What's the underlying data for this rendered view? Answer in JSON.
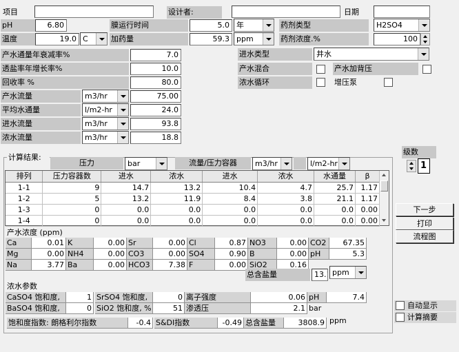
{
  "top": {
    "project_label": "项目",
    "project_value": "",
    "designer_label": "设计者:",
    "designer_value": "",
    "date_label": "日期",
    "date_value": "",
    "ph_label": "pH",
    "ph_value": "6.80",
    "membrane_time_label": "膜运行时间",
    "membrane_time_value": "5.0",
    "membrane_time_unit": "年",
    "chemical_type_label": "药剂类型",
    "chemical_type_value": "H2SO4",
    "temp_label": "温度",
    "temp_value": "19.0",
    "temp_unit": "C",
    "dosage_label": "加药量",
    "dosage_value": "59.3",
    "dosage_unit": "ppm",
    "chem_conc_label": "药剂浓度.%",
    "chem_conc_value": "100"
  },
  "params": {
    "decline_label": "产水通量年衰减率%",
    "decline_value": "7.0",
    "passage_label": "透盐率年增长率%",
    "passage_value": "10.0",
    "recovery_label": "回收率 %",
    "recovery_value": "80.0",
    "product_flow_label": "产水流量",
    "product_flow_unit": "m3/hr",
    "product_flow_value": "75.00",
    "avg_flux_label": "平均水通量",
    "avg_flux_unit": "l/m2-hr",
    "avg_flux_value": "24.0",
    "feed_flow_label": "进水流量",
    "feed_flow_unit": "m3/hr",
    "feed_flow_value": "93.8",
    "conc_flow_label": "浓水流量",
    "conc_flow_unit": "m3/hr",
    "conc_flow_value": "18.8"
  },
  "feed": {
    "type_label": "进水类型",
    "type_value": "井水",
    "product_mix_label": "产水混合",
    "product_backpressure_label": "产水加背压",
    "conc_recycle_label": "浓水循环",
    "booster_label": "增压泵"
  },
  "stages": {
    "label": "级数",
    "value": "1"
  },
  "results": {
    "title": "计算结果:",
    "pressure_label": "压力",
    "pressure_unit": "bar",
    "flow_vessel_label": "流量/压力容器",
    "flow_unit": "m3/hr",
    "flux_unit": "l/m2-hr",
    "columns": [
      "排列",
      "压力容器数",
      "进水",
      "浓水",
      "进水",
      "浓水",
      "水通量",
      "β"
    ],
    "rows": [
      [
        "1-1",
        "9",
        "14.7",
        "13.2",
        "10.4",
        "4.7",
        "25.7",
        "1.17"
      ],
      [
        "1-2",
        "5",
        "13.2",
        "11.9",
        "8.4",
        "3.8",
        "21.1",
        "1.17"
      ],
      [
        "1-3",
        "0",
        "0.0",
        "0.0",
        "0.0",
        "0.0",
        "0.0",
        "0.00"
      ],
      [
        "1-4",
        "0",
        "0.0",
        "0.0",
        "0.0",
        "0.0",
        "0.0",
        "0.00"
      ]
    ]
  },
  "product_conc": {
    "title": "产水浓度 (ppm)",
    "rows": [
      [
        [
          "Ca",
          "0.01"
        ],
        [
          "K",
          "0.00"
        ],
        [
          "Sr",
          "0.00"
        ],
        [
          "Cl",
          "0.87"
        ],
        [
          "NO3",
          "0.00"
        ],
        [
          "CO2",
          "67.35"
        ]
      ],
      [
        [
          "Mg",
          "0.00"
        ],
        [
          "NH4",
          "0.00"
        ],
        [
          "CO3",
          "0.00"
        ],
        [
          "SO4",
          "0.90"
        ],
        [
          "B",
          "0.00"
        ],
        [
          "pH",
          "5.3"
        ]
      ],
      [
        [
          "Na",
          "3.77"
        ],
        [
          "Ba",
          "0.00"
        ],
        [
          "HCO3",
          "7.38"
        ],
        [
          "F",
          "0.00"
        ],
        [
          "SiO2",
          "0.16"
        ],
        [
          "",
          ""
        ]
      ]
    ],
    "tds_label": "总含盐量",
    "tds_value": "13.1",
    "tds_unit": "ppm"
  },
  "conc_params": {
    "title": "浓水参数",
    "caso4_label": "CaSO4 饱和度,",
    "caso4_value": "1",
    "srso4_label": "SrSO4 饱和度,",
    "srso4_value": "0",
    "ionic_label": "离子强度",
    "ionic_value": "0.06",
    "ph_label": "pH",
    "ph_value": "7.4",
    "baso4_label": "BaSO4 饱和度,",
    "baso4_value": "0",
    "sio2_label": "SiO2 饱和度, %",
    "sio2_value": "51",
    "osmotic_label": "渗透压",
    "osmotic_value": "2.1",
    "osmotic_unit": "bar",
    "saturation_label": "饱和度指数: 朗格利尔指数",
    "lsi_value": "-0.4",
    "sdi_label": "S&DI指数",
    "sdi_value": "-0.49",
    "tds_label": "总含盐量",
    "tds_value": "3808.9",
    "tds_unit": "ppm"
  },
  "buttons": {
    "next": "下一步",
    "print": "打印",
    "flowchart": "流程图"
  },
  "options": {
    "auto_display": "自动显示",
    "calc_summary": "计算摘要"
  }
}
